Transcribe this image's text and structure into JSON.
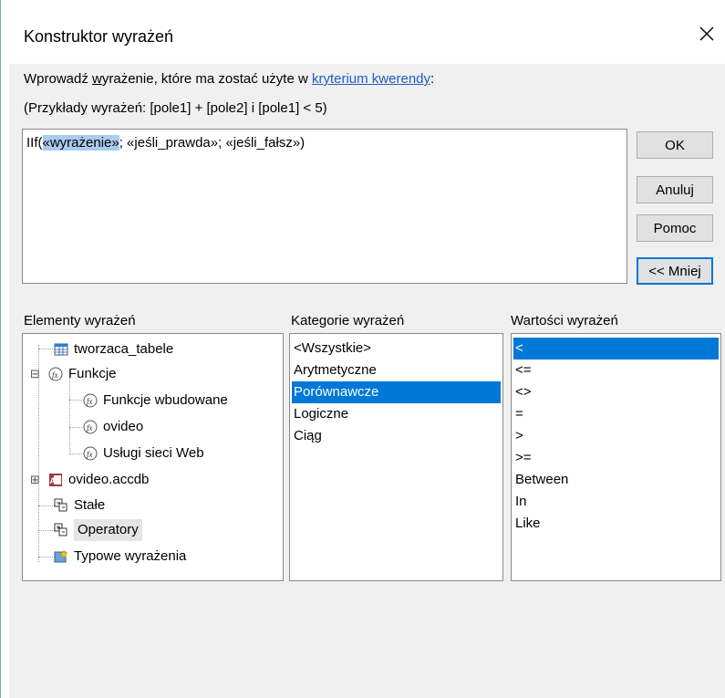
{
  "dialog": {
    "title": "Konstruktor wyrażeń",
    "prompt_pre": "Wprowadź ",
    "prompt_underlined": "w",
    "prompt_mid": "yrażenie, które ma zostać użyte w ",
    "prompt_link": "kryterium kwerendy",
    "prompt_post": ":",
    "examples": "(Przykłady wyrażeń: [pole1] + [pole2] i [pole1] < 5)"
  },
  "expression": {
    "prefix": "IIf(",
    "highlighted": "«wyrażenie»",
    "suffix": "; «jeśli_prawda»; «jeśli_fałsz»)"
  },
  "buttons": {
    "ok": "OK",
    "cancel": "Anuluj",
    "help": "Pomoc",
    "less": "<< Mniej"
  },
  "elements": {
    "label": "Elementy wyrażeń",
    "items": [
      {
        "label": "tworzaca_tabele",
        "icon": "query-icon"
      },
      {
        "label": "Funkcje",
        "icon": "function-icon",
        "expander": "⊟"
      },
      {
        "label": "Funkcje wbudowane",
        "icon": "function-icon"
      },
      {
        "label": "ovideo",
        "icon": "function-icon"
      },
      {
        "label": "Usługi sieci Web",
        "icon": "function-icon"
      },
      {
        "label": "ovideo.accdb",
        "icon": "access-db-icon",
        "expander": "⊞"
      },
      {
        "label": "Stałe",
        "icon": "constants-icon"
      },
      {
        "label": "Operatory",
        "icon": "operators-icon",
        "selected": true
      },
      {
        "label": "Typowe wyrażenia",
        "icon": "common-expressions-icon"
      }
    ]
  },
  "categories": {
    "label": "Kategorie wyrażeń",
    "items": [
      "<Wszystkie>",
      "Arytmetyczne",
      "Porównawcze",
      "Logiczne",
      "Ciąg"
    ],
    "selected": "Porównawcze"
  },
  "values": {
    "label": "Wartości wyrażeń",
    "items": [
      "<",
      "<=",
      "<>",
      "=",
      ">",
      ">=",
      "Between",
      "In",
      "Like"
    ],
    "selected": "<"
  },
  "colors": {
    "selection": "#0078d7",
    "link": "#1a5fc7",
    "highlight": "#a9cbef"
  }
}
